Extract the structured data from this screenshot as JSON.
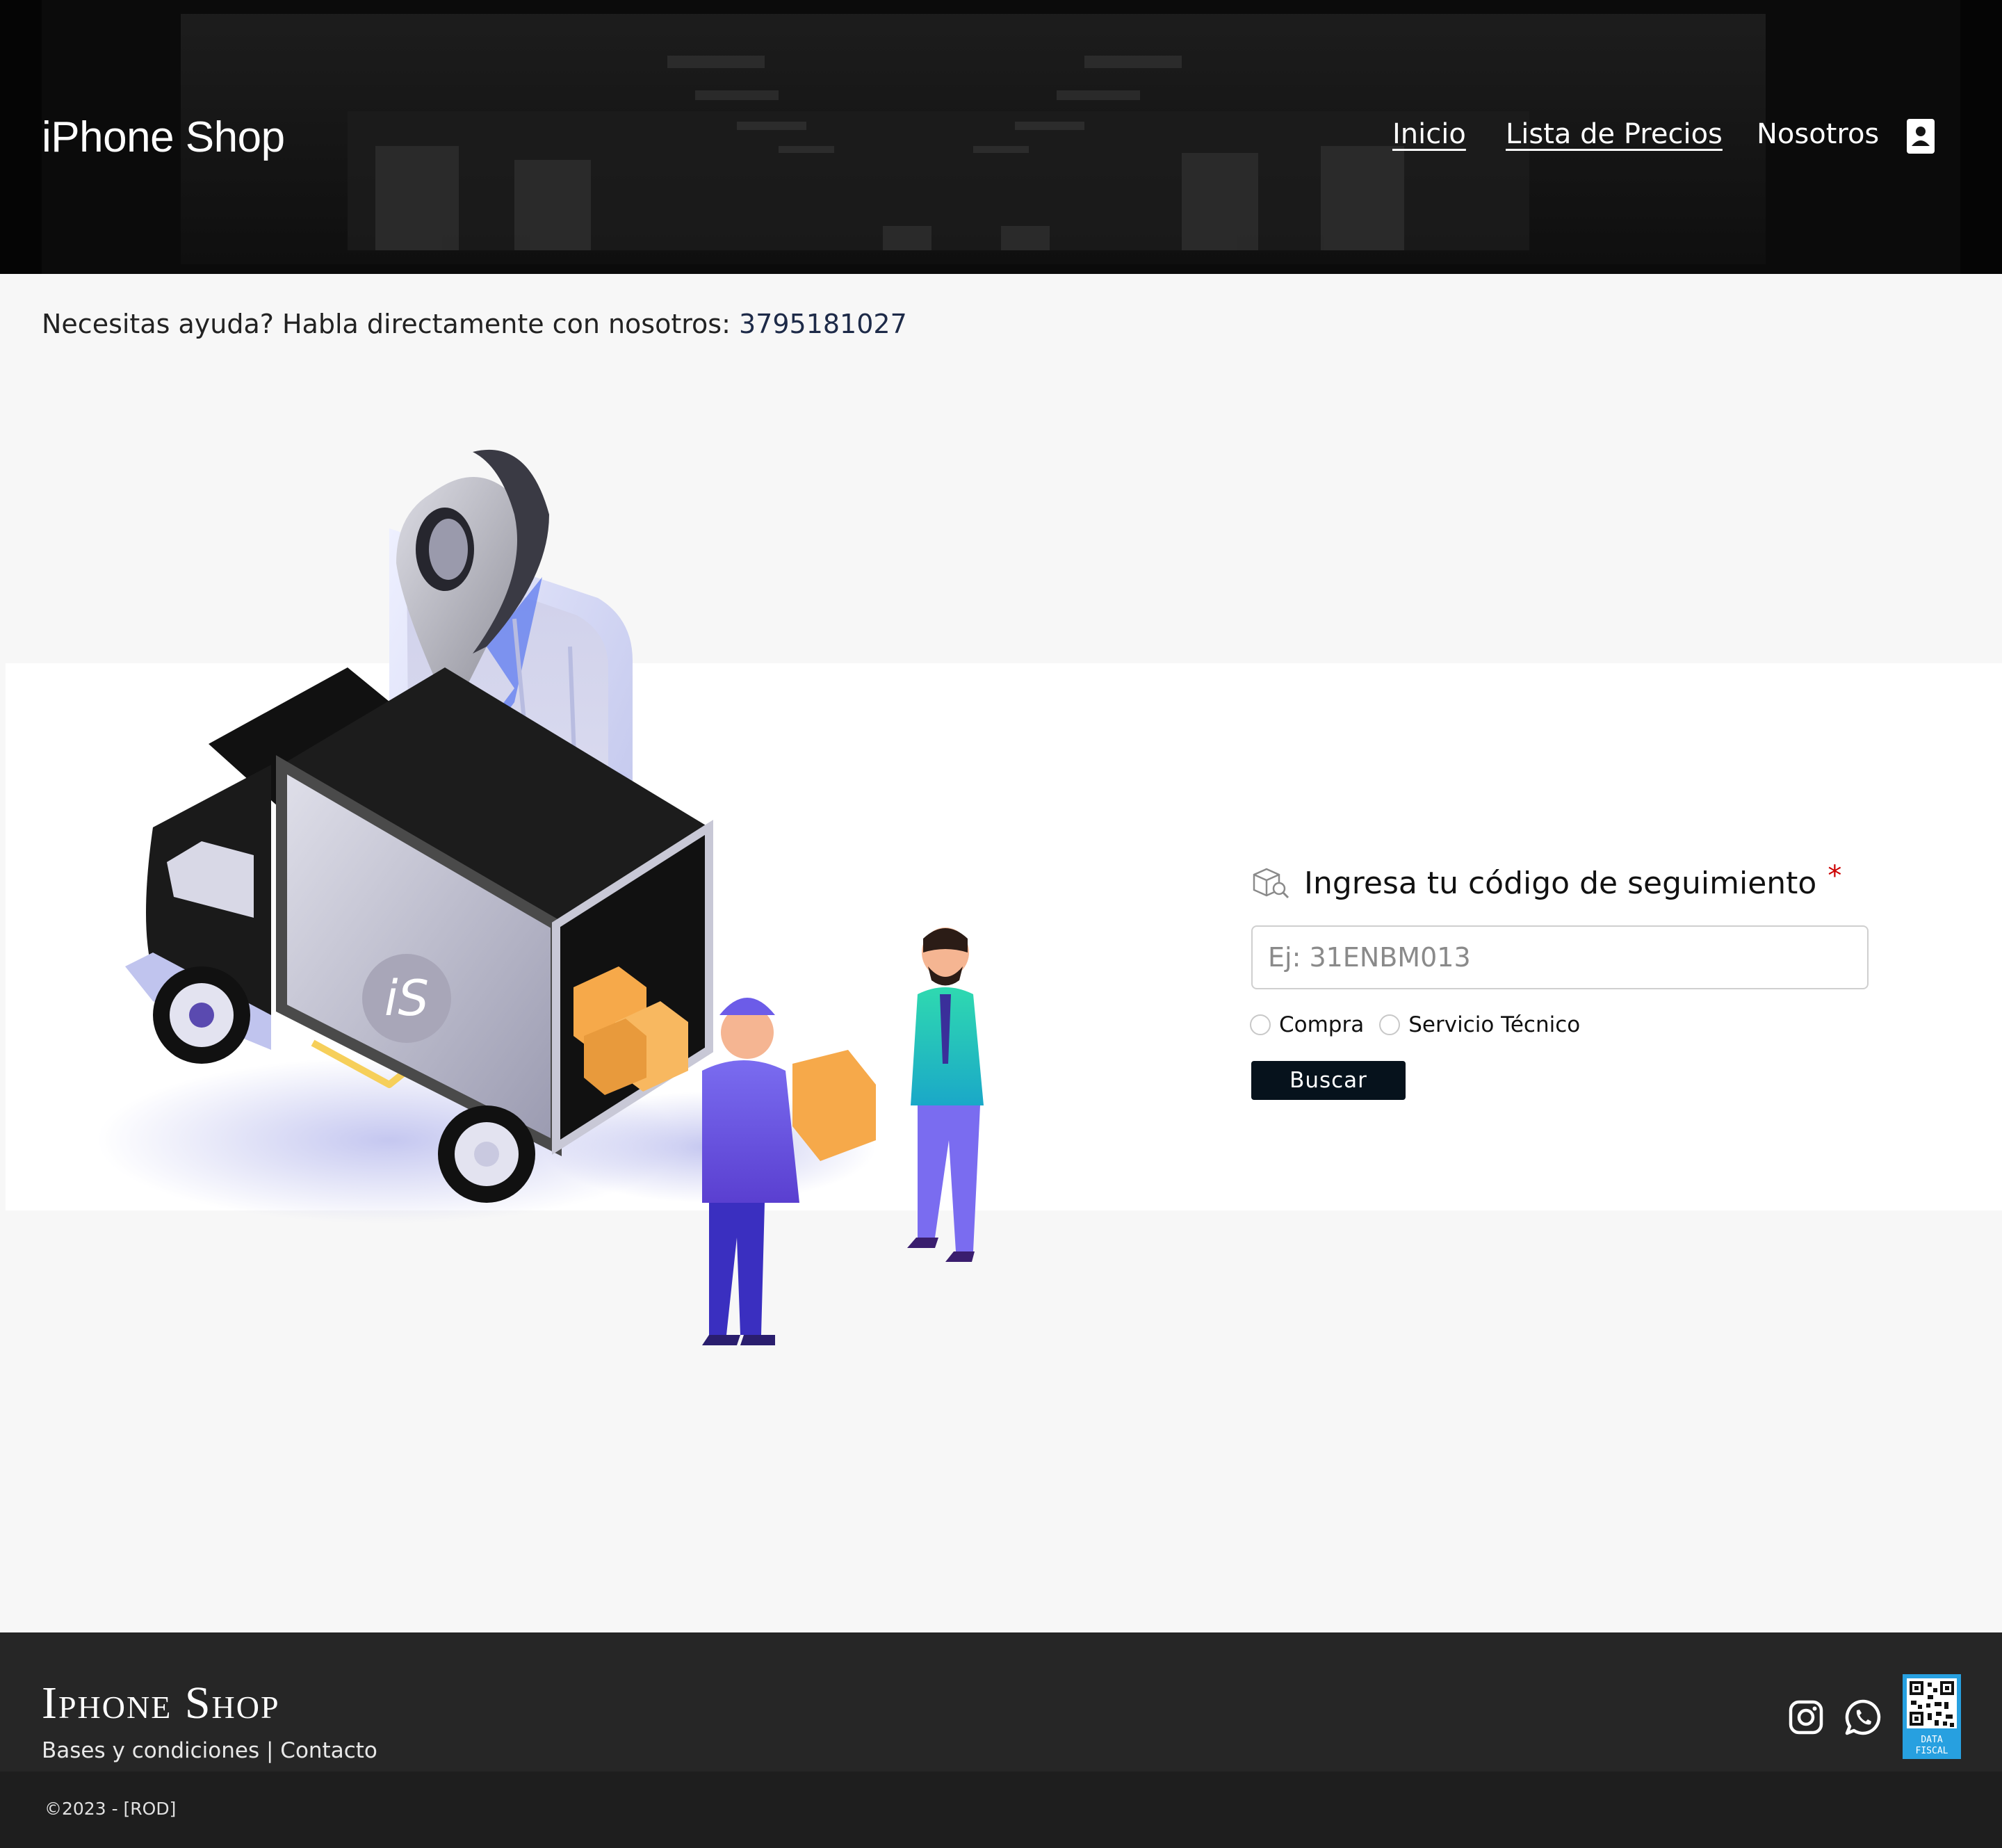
{
  "header": {
    "brand": "iPhone Shop",
    "nav": [
      {
        "label": "Inicio"
      },
      {
        "label": "Lista de Precios"
      },
      {
        "label": "Nosotros"
      }
    ],
    "contact_icon": "contact-card-icon"
  },
  "help": {
    "text": "Necesitas ayuda? Habla directamente con nosotros:",
    "phone": "3795181027"
  },
  "illustration": {
    "truck_logo": "iS"
  },
  "tracking_form": {
    "icon": "package-search-icon",
    "label": "Ingresa tu código de seguimiento",
    "required_mark": "*",
    "input_value": "",
    "input_placeholder": "Ej: 31ENBM013",
    "options": [
      {
        "label": "Compra",
        "selected": false
      },
      {
        "label": "Servicio Técnico",
        "selected": false
      }
    ],
    "submit_label": "Buscar"
  },
  "footer": {
    "brand": "Iphone Shop",
    "links": {
      "terms": "Bases y condiciones",
      "separator": " | ",
      "contact": "Contacto"
    },
    "social": [
      "instagram-icon",
      "whatsapp-icon"
    ],
    "qr_label_1": "DATA",
    "qr_label_2": "FISCAL",
    "copyright": "©2023 - [ROD]"
  },
  "colors": {
    "header_bg": "#141414",
    "page_bg": "#f7f7f7",
    "footer_bg": "#262626",
    "subfooter_bg": "#1e1e1e",
    "button_bg": "#06121c",
    "required": "#cc0000",
    "qr_bg": "#27a0e0"
  }
}
